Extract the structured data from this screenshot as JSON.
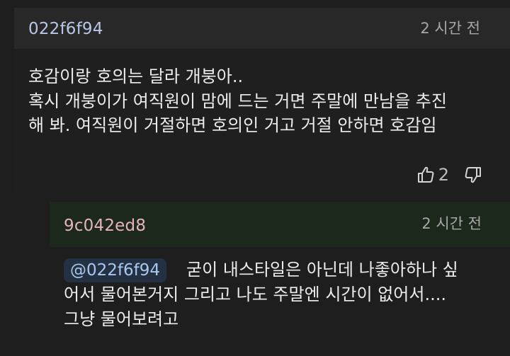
{
  "comment": {
    "author": "022f6f94",
    "time": "2 시간 전",
    "body_lines": [
      "호감이랑 호의는 달라 개붕아..",
      "혹시 개붕이가 여직원이 맘에 드는 거면 주말에 만남을 추진",
      "해 봐. 여직원이 거절하면 호의인 거고 거절 안하면 호감임"
    ],
    "likes": "2",
    "icons": {
      "like": "thumbs-up-icon",
      "dislike": "thumbs-down-icon"
    },
    "colors": {
      "author": "#b8c7e6",
      "header_bg": "#282828"
    }
  },
  "reply": {
    "author": "9c042ed8",
    "time": "2 시간 전",
    "mention": "@022f6f94",
    "body_lines": [
      "굳이 내스타일은 아닌데 나좋아하나 싶",
      "어서 물어본거지 그리고 나도 주말엔 시간이 없어서....",
      "그냥 물어보려고"
    ],
    "colors": {
      "author": "#e4b4b8",
      "header_bg": "#1d281d",
      "mention_bg": "#243143"
    }
  }
}
